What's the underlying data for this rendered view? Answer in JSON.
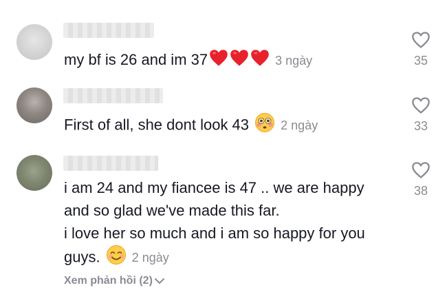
{
  "comments": [
    {
      "text": "my bf is 26 and im 37",
      "emojis": [
        "red-heart",
        "red-heart",
        "red-heart"
      ],
      "time": "3 ngày",
      "likes": "35"
    },
    {
      "text": "First of all, she dont look 43",
      "emojis": [
        "flushed-face"
      ],
      "time": "2 ngày",
      "likes": "33"
    },
    {
      "lines": [
        "i am 24 and my fiancee is 47 .. we are happy",
        "and so glad we've made this far.",
        "i love her so much and i am so happy for you",
        "guys."
      ],
      "emojis": [
        "smiling-face"
      ],
      "time": "2 ngày",
      "likes": "38",
      "replies": "Xem phản hồi (2)"
    }
  ],
  "colors": {
    "text": "#161823",
    "muted": "#8a8b91",
    "heart_red": "#e8222c"
  }
}
